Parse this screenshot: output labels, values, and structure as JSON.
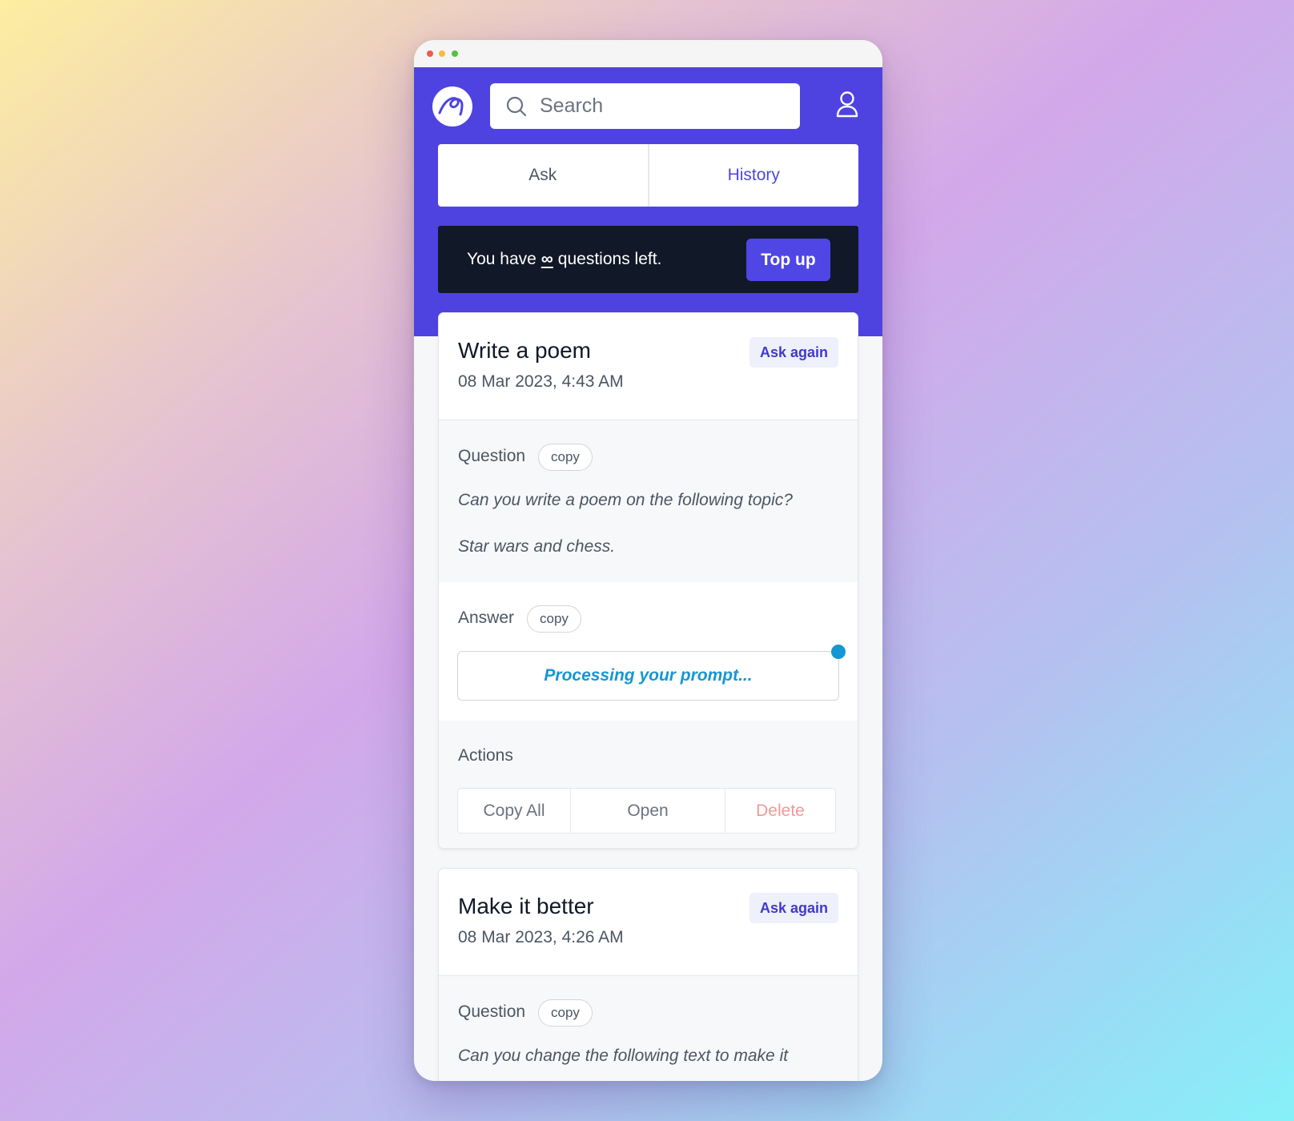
{
  "header": {
    "search_placeholder": "Search"
  },
  "tabs": [
    {
      "label": "Ask"
    },
    {
      "label": "History",
      "active": true
    }
  ],
  "banner": {
    "prefix": "You have",
    "amount": "∞",
    "suffix": "questions left.",
    "topup_label": "Top up"
  },
  "history": [
    {
      "title": "Write a poem",
      "date": "08 Mar 2023, 4:43 AM",
      "ask_again_label": "Ask again",
      "question_label": "Question",
      "question_copy_label": "copy",
      "question_lines": [
        "Can you write a poem on the following topic?",
        "Star wars and chess."
      ],
      "answer_label": "Answer",
      "answer_copy_label": "copy",
      "answer_status": "Processing your prompt...",
      "actions_label": "Actions",
      "actions": {
        "copy_all": "Copy All",
        "open": "Open",
        "delete": "Delete"
      }
    },
    {
      "title": "Make it better",
      "date": "08 Mar 2023, 4:26 AM",
      "ask_again_label": "Ask again",
      "question_label": "Question",
      "question_copy_label": "copy",
      "question_lines": [
        "Can you change the following text to make it"
      ]
    }
  ],
  "colors": {
    "brand": "#4e43e1",
    "banner_bg": "#111827",
    "processing": "#1597d4",
    "delete": "#ef9a9a"
  },
  "icons": {
    "logo": "brand-logo",
    "search": "search-icon",
    "user": "user-icon"
  }
}
